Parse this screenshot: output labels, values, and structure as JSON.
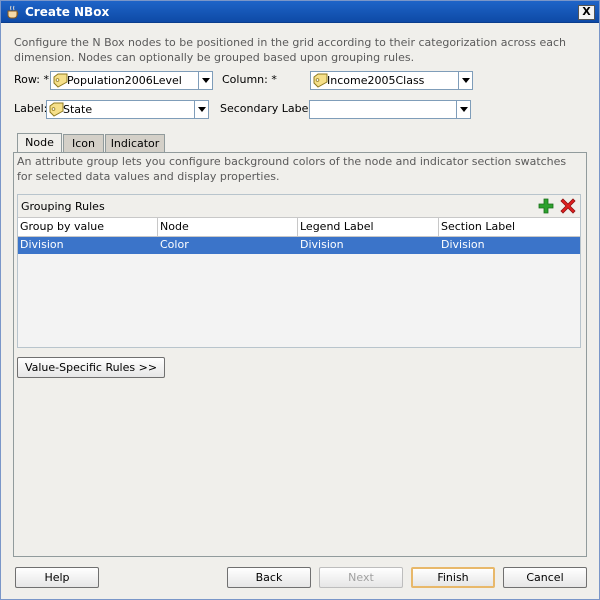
{
  "window": {
    "title": "Create NBox",
    "close_glyph": "X"
  },
  "description": "Configure the N Box nodes to be positioned in the grid according to their categorization across each dimension. Nodes can optionally be grouped based upon grouping rules.",
  "fields": {
    "row_label": "Row: *",
    "row_value": "Population2006Level",
    "column_label": "Column: *",
    "column_value": "Income2005Class",
    "label_label": "Label:",
    "label_value": "State",
    "secondary_label": "Secondary Label:",
    "secondary_value": ""
  },
  "tabs": [
    {
      "label": "Node",
      "active": true
    },
    {
      "label": "Icon",
      "active": false
    },
    {
      "label": "Indicator",
      "active": false
    }
  ],
  "panel": {
    "description": "An attribute group lets you configure background colors of the node and indicator section swatches for selected data values and display properties.",
    "grouping_title": "Grouping Rules",
    "columns": [
      "Group by value",
      "Node",
      "Legend Label",
      "Section Label"
    ],
    "rows": [
      [
        "Division",
        "Color",
        "Division",
        "Division"
      ]
    ],
    "value_specific_button": "Value-Specific Rules >>"
  },
  "buttons": {
    "help": "Help",
    "back": "Back",
    "next": "Next",
    "finish": "Finish",
    "cancel": "Cancel"
  },
  "icons": {
    "app": "coffee-cup-icon",
    "tag": "tag-icon",
    "add": "add-icon",
    "delete": "delete-icon"
  },
  "colors": {
    "titlebar": "#1e64c8",
    "selection": "#3b74c9",
    "add_icon": "#2da12d",
    "delete_icon": "#e02020"
  }
}
